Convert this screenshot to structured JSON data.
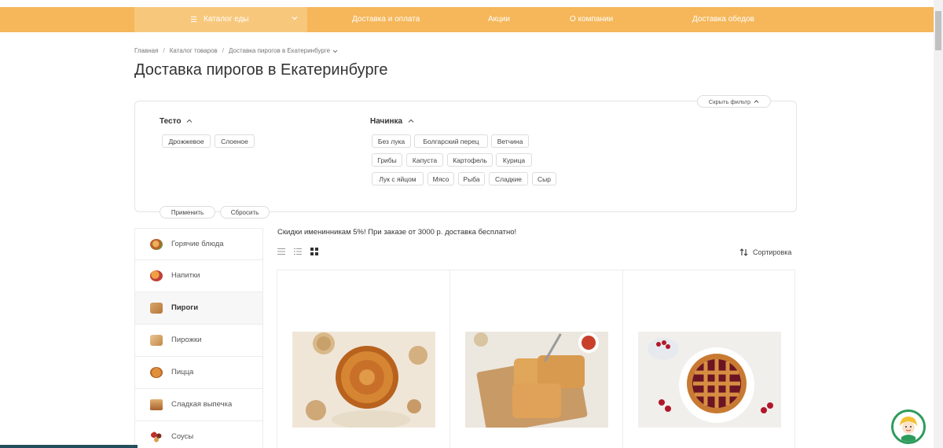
{
  "nav": {
    "catalog_label": "Каталог еды",
    "links": [
      "Доставка и оплата",
      "Акции",
      "О компании",
      "Доставка обедов"
    ]
  },
  "breadcrumb": [
    "Главная",
    "Каталог товаров",
    "Доставка пирогов в Екатеринбурге"
  ],
  "page_title": "Доставка пирогов в Екатеринбурге",
  "filter": {
    "hide_label": "Скрыть фильтр",
    "groups": [
      {
        "title": "Тесто",
        "options": [
          "Дрожжевое",
          "Слоеное"
        ]
      },
      {
        "title": "Начинка",
        "options": [
          "Без лука",
          "Болгарский перец",
          "Ветчина",
          "Грибы",
          "Капуста",
          "Картофель",
          "Курица",
          "Лук с яйцом",
          "Мясо",
          "Рыба",
          "Сладкие",
          "Сыр"
        ]
      }
    ],
    "apply_label": "Применить",
    "reset_label": "Сбросить"
  },
  "sidebar": {
    "items": [
      {
        "label": "Горячие блюда",
        "icon": "hot-dish-icon",
        "active": false
      },
      {
        "label": "Напитки",
        "icon": "drinks-icon",
        "active": false
      },
      {
        "label": "Пироги",
        "icon": "pie-icon",
        "active": true
      },
      {
        "label": "Пирожки",
        "icon": "small-pie-icon",
        "active": false
      },
      {
        "label": "Пицца",
        "icon": "pizza-icon",
        "active": false
      },
      {
        "label": "Сладкая выпечка",
        "icon": "sweet-pastry-icon",
        "active": false
      },
      {
        "label": "Соусы",
        "icon": "sauce-icon",
        "active": false
      }
    ]
  },
  "promo_text": "Скидки именинникам 5%! При заказе от 3000 р. доставка бесплатно!",
  "sort_label": "Сортировка",
  "view_modes": [
    "list-view-icon",
    "compact-list-icon",
    "grid-view-icon"
  ],
  "active_view": "grid-view-icon",
  "colors": {
    "accent": "#f5b75a",
    "accent_light": "#f7c87c"
  }
}
